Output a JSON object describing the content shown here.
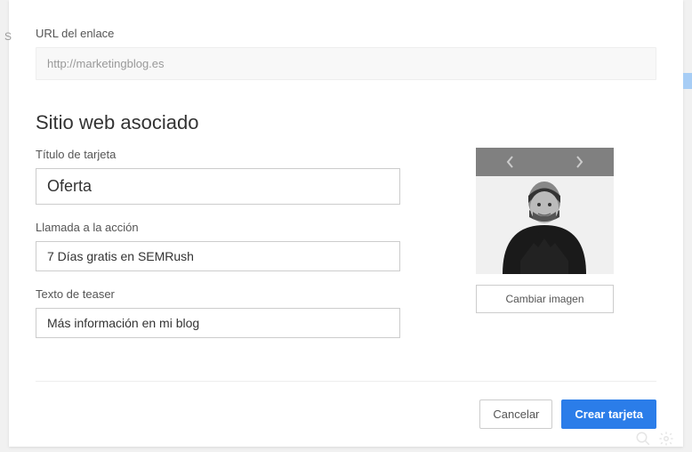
{
  "url_section": {
    "label": "URL del enlace",
    "value": "http://marketingblog.es"
  },
  "section_title": "Sitio web asociado",
  "card_title": {
    "label": "Título de tarjeta",
    "value": "Oferta"
  },
  "cta": {
    "label": "Llamada a la acción",
    "value": "7 Días gratis en SEMRush"
  },
  "teaser": {
    "label": "Texto de teaser",
    "value": "Más información en mi blog"
  },
  "change_image_label": "Cambiar imagen",
  "footer": {
    "cancel": "Cancelar",
    "create": "Crear tarjeta"
  },
  "bg_letter": "S"
}
